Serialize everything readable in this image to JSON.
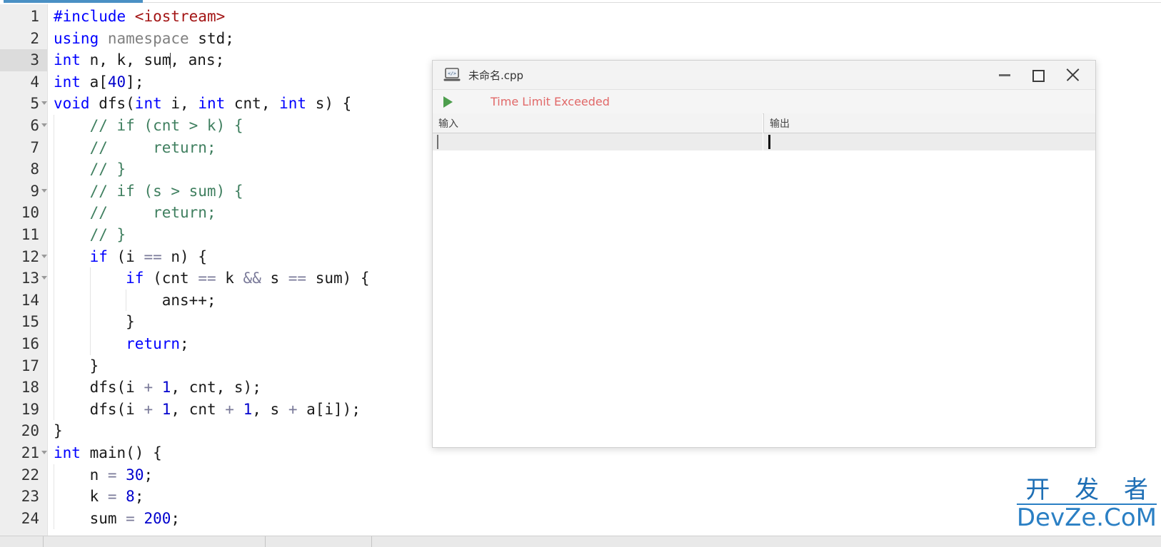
{
  "app": {
    "editor_filename": "未命名.cpp"
  },
  "editor": {
    "gutter_first_line": 1,
    "lines": [
      {
        "n": "1",
        "fold": false,
        "indent": 0,
        "tokens": [
          {
            "t": "#include ",
            "c": "k"
          },
          {
            "t": "<iostream>",
            "c": "str"
          }
        ]
      },
      {
        "n": "2",
        "fold": false,
        "indent": 0,
        "tokens": [
          {
            "t": "using ",
            "c": "k"
          },
          {
            "t": "namespace",
            "c": "gray"
          },
          {
            "t": " std;",
            "c": "pl"
          }
        ]
      },
      {
        "n": "3",
        "fold": false,
        "indent": 0,
        "current": true,
        "caret_after": 3,
        "tokens": [
          {
            "t": "int",
            "c": "k"
          },
          {
            "t": " n, k, sum",
            "c": "pl"
          },
          {
            "t": "|",
            "c": "caret"
          },
          {
            "t": ", ans;",
            "c": "pl"
          }
        ]
      },
      {
        "n": "4",
        "fold": false,
        "indent": 0,
        "tokens": [
          {
            "t": "int",
            "c": "k"
          },
          {
            "t": " a[",
            "c": "pl"
          },
          {
            "t": "40",
            "c": "num"
          },
          {
            "t": "];",
            "c": "pl"
          }
        ]
      },
      {
        "n": "5",
        "fold": true,
        "indent": 0,
        "tokens": [
          {
            "t": "void",
            "c": "k"
          },
          {
            "t": " dfs(",
            "c": "pl"
          },
          {
            "t": "int",
            "c": "k"
          },
          {
            "t": " i, ",
            "c": "pl"
          },
          {
            "t": "int",
            "c": "k"
          },
          {
            "t": " cnt, ",
            "c": "pl"
          },
          {
            "t": "int",
            "c": "k"
          },
          {
            "t": " s) {",
            "c": "pl"
          }
        ]
      },
      {
        "n": "6",
        "fold": true,
        "indent": 1,
        "tokens": [
          {
            "t": "    // if (cnt > k) {",
            "c": "cm"
          }
        ]
      },
      {
        "n": "7",
        "fold": false,
        "indent": 1,
        "tokens": [
          {
            "t": "    //     return;",
            "c": "cm"
          }
        ]
      },
      {
        "n": "8",
        "fold": false,
        "indent": 1,
        "tokens": [
          {
            "t": "    // }",
            "c": "cm"
          }
        ]
      },
      {
        "n": "9",
        "fold": true,
        "indent": 1,
        "tokens": [
          {
            "t": "    // if (s > sum) {",
            "c": "cm"
          }
        ]
      },
      {
        "n": "10",
        "fold": false,
        "indent": 1,
        "tokens": [
          {
            "t": "    //     return;",
            "c": "cm"
          }
        ]
      },
      {
        "n": "11",
        "fold": false,
        "indent": 1,
        "tokens": [
          {
            "t": "    // }",
            "c": "cm"
          }
        ]
      },
      {
        "n": "12",
        "fold": true,
        "indent": 1,
        "tokens": [
          {
            "t": "    ",
            "c": "pl"
          },
          {
            "t": "if",
            "c": "k"
          },
          {
            "t": " (i ",
            "c": "pl"
          },
          {
            "t": "==",
            "c": "op"
          },
          {
            "t": " n) {",
            "c": "pl"
          }
        ]
      },
      {
        "n": "13",
        "fold": true,
        "indent": 2,
        "tokens": [
          {
            "t": "        ",
            "c": "pl"
          },
          {
            "t": "if",
            "c": "k"
          },
          {
            "t": " (cnt ",
            "c": "pl"
          },
          {
            "t": "==",
            "c": "op"
          },
          {
            "t": " k ",
            "c": "pl"
          },
          {
            "t": "&&",
            "c": "op"
          },
          {
            "t": " s ",
            "c": "pl"
          },
          {
            "t": "==",
            "c": "op"
          },
          {
            "t": " sum) {",
            "c": "pl"
          }
        ]
      },
      {
        "n": "14",
        "fold": false,
        "indent": 3,
        "tokens": [
          {
            "t": "            ans++;",
            "c": "pl"
          }
        ]
      },
      {
        "n": "15",
        "fold": false,
        "indent": 2,
        "tokens": [
          {
            "t": "        }",
            "c": "pl"
          }
        ]
      },
      {
        "n": "16",
        "fold": false,
        "indent": 2,
        "tokens": [
          {
            "t": "        ",
            "c": "pl"
          },
          {
            "t": "return",
            "c": "k"
          },
          {
            "t": ";",
            "c": "pl"
          }
        ]
      },
      {
        "n": "17",
        "fold": false,
        "indent": 1,
        "tokens": [
          {
            "t": "    }",
            "c": "pl"
          }
        ]
      },
      {
        "n": "18",
        "fold": false,
        "indent": 1,
        "tokens": [
          {
            "t": "    dfs(i ",
            "c": "pl"
          },
          {
            "t": "+",
            "c": "op"
          },
          {
            "t": " ",
            "c": "pl"
          },
          {
            "t": "1",
            "c": "num"
          },
          {
            "t": ", cnt, s);",
            "c": "pl"
          }
        ]
      },
      {
        "n": "19",
        "fold": false,
        "indent": 1,
        "tokens": [
          {
            "t": "    dfs(i ",
            "c": "pl"
          },
          {
            "t": "+",
            "c": "op"
          },
          {
            "t": " ",
            "c": "pl"
          },
          {
            "t": "1",
            "c": "num"
          },
          {
            "t": ", cnt ",
            "c": "pl"
          },
          {
            "t": "+",
            "c": "op"
          },
          {
            "t": " ",
            "c": "pl"
          },
          {
            "t": "1",
            "c": "num"
          },
          {
            "t": ", s ",
            "c": "pl"
          },
          {
            "t": "+",
            "c": "op"
          },
          {
            "t": " a[i]);",
            "c": "pl"
          }
        ]
      },
      {
        "n": "20",
        "fold": false,
        "indent": 0,
        "tokens": [
          {
            "t": "}",
            "c": "pl"
          }
        ]
      },
      {
        "n": "21",
        "fold": true,
        "indent": 0,
        "tokens": [
          {
            "t": "int",
            "c": "k"
          },
          {
            "t": " main() {",
            "c": "pl"
          }
        ]
      },
      {
        "n": "22",
        "fold": false,
        "indent": 1,
        "tokens": [
          {
            "t": "    n ",
            "c": "pl"
          },
          {
            "t": "=",
            "c": "op"
          },
          {
            "t": " ",
            "c": "pl"
          },
          {
            "t": "30",
            "c": "num"
          },
          {
            "t": ";",
            "c": "pl"
          }
        ]
      },
      {
        "n": "23",
        "fold": false,
        "indent": 1,
        "tokens": [
          {
            "t": "    k ",
            "c": "pl"
          },
          {
            "t": "=",
            "c": "op"
          },
          {
            "t": " ",
            "c": "pl"
          },
          {
            "t": "8",
            "c": "num"
          },
          {
            "t": ";",
            "c": "pl"
          }
        ]
      },
      {
        "n": "24",
        "fold": false,
        "indent": 1,
        "tokens": [
          {
            "t": "    sum ",
            "c": "pl"
          },
          {
            "t": "=",
            "c": "op"
          },
          {
            "t": " ",
            "c": "pl"
          },
          {
            "t": "200",
            "c": "num"
          },
          {
            "t": ";",
            "c": "pl"
          }
        ]
      }
    ]
  },
  "dialog": {
    "title": "未命名.cpp",
    "icon": "laptop-code-icon",
    "minimize_label": "—",
    "maximize_label": "□",
    "close_label": "✕",
    "run_icon": "play-triangle-icon",
    "status_text": "Time Limit Exceeded",
    "status_color": "#e16868",
    "run_color": "#4d9e4d",
    "input_panel": {
      "header": "输入",
      "value": "",
      "placeholder": ""
    },
    "output_panel": {
      "header": "输出",
      "value": "",
      "placeholder": ""
    }
  },
  "watermark": {
    "cn": "开 发 者",
    "en": "DevZe.CoM",
    "color": "#2a7fc4"
  }
}
